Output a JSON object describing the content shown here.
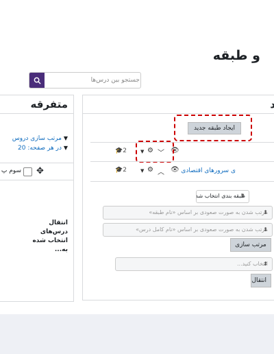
{
  "page": {
    "title": "و طبقه"
  },
  "search": {
    "placeholder": "جستجو بین درس‌ها"
  },
  "misc_panel": {
    "title": "متفرقه",
    "sort_label": "مرتب سازی دروس",
    "per_page_label": "در هر صفحه: 20",
    "course_name": "سوم پ",
    "move_selected": "انتقال درس‌های انتخاب شده به..."
  },
  "categories_panel": {
    "title_edge": "د",
    "create_button": "ایجاد طبقه جدید",
    "rows": [
      {
        "name": "",
        "count": "2"
      },
      {
        "name": "ی سرورهای اقتصادی",
        "count": "2"
      }
    ],
    "category_select": "طبقه بندی انتخاب شده",
    "sort_by_name": "مرتب شدن به صورت صعودی بر اساس «نام طبقه»",
    "sort_by_fullname": "مرتب شدن به صورت صعودی بر اساس «نام کامل درس»",
    "sort_button": "مرتب سازی",
    "choose_placeholder": "انتخاب کنید...",
    "move_button": "انتقال"
  },
  "colors": {
    "accent": "#4a2d7a",
    "link": "#0f6cbf",
    "highlight": "#cc0000"
  }
}
